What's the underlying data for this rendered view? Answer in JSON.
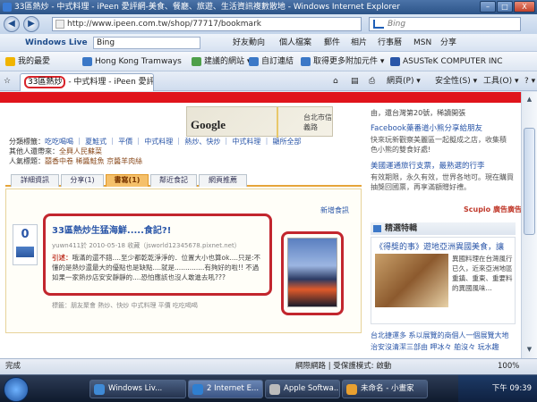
{
  "window": {
    "title": "33區熱炒 - 中式料理 - iPeen 愛評網-美食、餐廳、旅遊、生活資訊複數散地 - Windows Internet Explorer",
    "min": "–",
    "max": "□",
    "close": "X"
  },
  "address": {
    "back": "◀",
    "forward": "▶",
    "url": "http://www.ipeen.com.tw/shop/77717/bookmark",
    "search_placeholder": "Bing"
  },
  "live_toolbar": {
    "brand": "Windows Live",
    "search_value": "Bing",
    "items": [
      "好友動向",
      "個人檔案",
      "郵件",
      "相片",
      "行事曆",
      "MSN",
      "分享"
    ]
  },
  "favorites_bar": {
    "items": [
      "我的最愛",
      "Hong Kong Tramways",
      "建議的網站 ▾",
      "自訂連結",
      "取得更多附加元件 ▾",
      "ASUSTeK COMPUTER INC"
    ]
  },
  "tabs": {
    "active_label": "33區熱炒",
    "active_rest": " - 中式料理 - iPeen 愛評網-...",
    "tools": [
      "網頁(P) ▾",
      "安全性(S) ▾",
      "工具(O) ▾",
      "? ▾"
    ]
  },
  "shop": {
    "category_label": "分類標籤：",
    "categories": "吃吃喝喝 ｜ 夏鮭式 ｜ 平價 ｜ 中式料理 ｜ 熱炒、快炒 ｜ 中式料理 ｜ 顯所全部",
    "others_label": "其他人還帶來：",
    "others": "全興人民蘇菜",
    "popular_label": "人氣標題：",
    "popular": "囍香中卷 稀醬鮭魚 京醬羊肉絲",
    "map_logo": "Google",
    "map_label": "台北市信義路",
    "info_tabs": [
      "詳細資訊",
      "分享(1)",
      "書寫(1)",
      "鄰近食記",
      "網頁推薦"
    ],
    "active_tab": "書寫(1)",
    "new_window": "新增食訊"
  },
  "post": {
    "count": "0",
    "title": "33區熱炒生猛海鮮.....食記?!",
    "meta": "yuwn411於 2010-05-18 收藏（jsworld12345678.pixnet.net）",
    "excerpt_label": "引述：",
    "excerpt": "哦滿的還不錯....至少都乾乾淨淨的．位置大小也算ok....只是:不懂的是熱炒還最大的優點也是缺點....就是..............有夠好的啦!! 不過如果一家熱炒店安安靜靜的....恐怕應該也沒人敢進去吼???",
    "tags": "標籤：朋友聚會 熱炒、快炒 中式料理 平價 吃吃喝喝"
  },
  "sidebar": {
    "line1": "由，還台灣第20號，稀讀開張",
    "fb_head": "Facebook藥番道小熊分享給朋友",
    "fb_lines": [
      "快來玩新觀察美麗區一起擬成之店，收集積",
      "色小熊的雙食好處!"
    ],
    "travel_head": "美國運通旅行支票，最熟選的行李",
    "travel_lines": [
      "有效期限，永久有效，世界各地可。現在購買",
      "抽獎回國票，再享滿額贈好禮。"
    ],
    "ad_label": "Scupio 廣告廣告",
    "picks_title": "精選特輯",
    "promo_title": "《得獎的事》遊地亞洲異國美食，讓",
    "promo_text": "異國料理在台灣風行已久，近來亞洲地區重鎮、重東、重要料的異國風味...",
    "bottom_lines": [
      "台北捷運多 系以展覽的商個人一個展覽大地",
      "治安沒清潔三部由 呷冰々 舶沒々 玩水趣"
    ]
  },
  "statusbar": {
    "left": "完成",
    "zone": "網際網路 | 受保護模式: 啟動",
    "zoom": "100%"
  },
  "taskbar": {
    "tasks": [
      "Windows Liv...",
      "2 Internet E...",
      "Apple Softwa...",
      "未命名 - 小畫家"
    ],
    "time": "下午 09:39"
  }
}
